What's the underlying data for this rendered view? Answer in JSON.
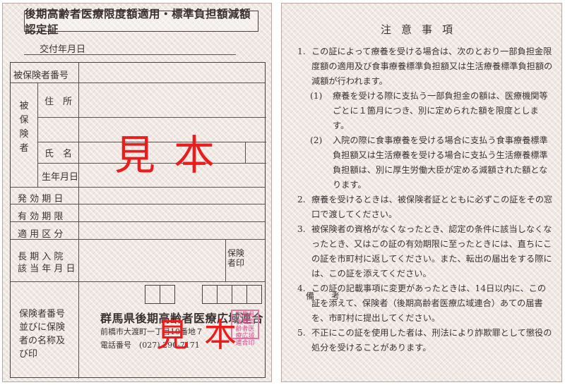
{
  "left_card": {
    "title": "後期高齢者医療限度額適用・標準負担額減額認定証",
    "issue_date_label": "交付年月日",
    "labels": {
      "insured_number": "被保険者番号",
      "insured_side": [
        "被",
        "保",
        "険",
        "者"
      ],
      "address": "住　所",
      "name": "氏　名",
      "birth_date": "生年月日",
      "effective_date": "発 効 期 日",
      "valid_until": "有 効 期 限",
      "applicable_category": "適 用 区 分",
      "long_hospital_1": "長 期 入 院",
      "long_hospital_2": "該 当 年 月 日",
      "insurer_seal_1": "保険",
      "insurer_seal_2": "者印",
      "insurer_info": [
        "保険者番号",
        "並びに保険",
        "者の名称及",
        "び印"
      ]
    },
    "insurer": {
      "name": "群馬県後期高齢者医療広域連合",
      "address": "前橋市大渡町一丁目10番地７",
      "phone": "電話番号　(027) 290-7171"
    },
    "stamp_text": "群馬県後期高齢者医療広域連合印",
    "sample_mark": "見本"
  },
  "right_card": {
    "title": "注意事項",
    "notes": [
      {
        "num": "1.",
        "text": "この証によって療養を受ける場合は、次のとおり一部負担金限度額の適用及び食事療養標準負担額又は生活療養標準負担額の減額が行われます。"
      },
      {
        "num": "(1)",
        "text": "療養を受ける際に支払う一部負担金の額は、医療機関等ごとに１箇月につき、別に定められた額を限度とします。",
        "sub": true
      },
      {
        "num": "(2)",
        "text": "入院の際に食事療養を受ける場合に支払う食事療養標準負担額又は生活療養を受ける場合に支払う生活療養標準負担額は、別に厚生労働大臣が定める減額された額となります。",
        "sub": true
      },
      {
        "num": "2.",
        "text": "療養を受けるときは、被保険者証とともに必ずこの証をその窓口で渡してください。"
      },
      {
        "num": "3.",
        "text": "被保険者の資格がなくなったとき、認定の条件に該当しなくなったとき、又はこの証の有効期限に至ったときには、直ちにこの証を市町村に返してください。また、転出の届出をする際には、この証を添えてください。"
      },
      {
        "num": "4.",
        "text": "この証の記載事項に変更があったときは、14日以内に、この証を添えて、保険者（後期高齢者医療広域連合）あての届書を、市町村に提出してください。"
      },
      {
        "num": "5.",
        "text": "不正にこの証を使用した者は、刑法により詐欺罪として懲役の処分を受けることがあります。"
      }
    ],
    "remarks_label": "備　考"
  }
}
